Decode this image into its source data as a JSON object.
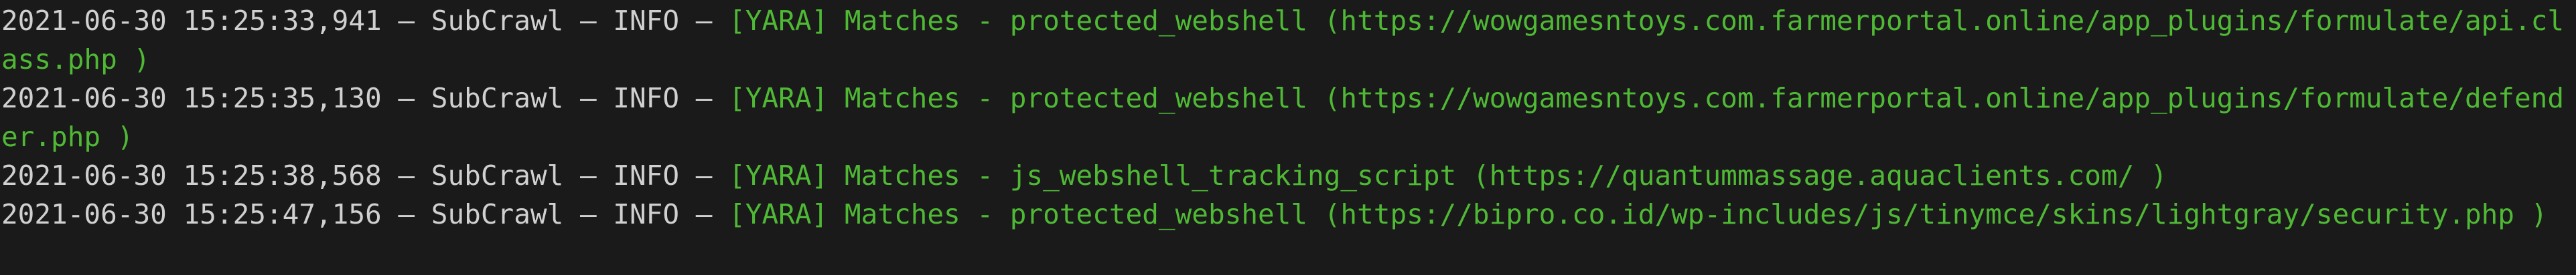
{
  "colors": {
    "background": "#1a1a1a",
    "prefix_text": "#d0d0d0",
    "message_text": "#4fb935"
  },
  "log": {
    "lines": [
      {
        "prefix": "2021-06-30 15:25:33,941 – SubCrawl – INFO – ",
        "message": "[YARA] Matches - protected_webshell (https://wowgamesntoys.com.farmerportal.online/app_plugins/formulate/api.class.php )"
      },
      {
        "prefix": "2021-06-30 15:25:35,130 – SubCrawl – INFO – ",
        "message": "[YARA] Matches - protected_webshell (https://wowgamesntoys.com.farmerportal.online/app_plugins/formulate/defender.php )"
      },
      {
        "prefix": "2021-06-30 15:25:38,568 – SubCrawl – INFO – ",
        "message": "[YARA] Matches - js_webshell_tracking_script (https://quantummassage.aquaclients.com/ )"
      },
      {
        "prefix": "2021-06-30 15:25:47,156 – SubCrawl – INFO – ",
        "message": "[YARA] Matches - protected_webshell (https://bipro.co.id/wp-includes/js/tinymce/skins/lightgray/security.php )"
      }
    ]
  }
}
